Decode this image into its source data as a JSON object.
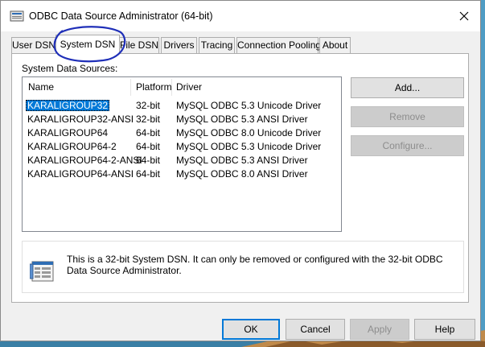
{
  "window": {
    "title": "ODBC Data Source Administrator (64-bit)"
  },
  "tabs": [
    {
      "label": "User DSN",
      "active": false
    },
    {
      "label": "System DSN",
      "active": true
    },
    {
      "label": "File DSN",
      "active": false
    },
    {
      "label": "Drivers",
      "active": false
    },
    {
      "label": "Tracing",
      "active": false
    },
    {
      "label": "Connection Pooling",
      "active": false
    },
    {
      "label": "About",
      "active": false
    }
  ],
  "panel": {
    "section_label": "System Data Sources:",
    "columns": [
      "Name",
      "Platform",
      "Driver"
    ],
    "rows": [
      {
        "name": "KARALIGROUP32",
        "platform": "32-bit",
        "driver": "MySQL ODBC 5.3 Unicode Driver",
        "selected": true
      },
      {
        "name": "KARALIGROUP32-ANSI",
        "platform": "32-bit",
        "driver": "MySQL ODBC 5.3 ANSI Driver",
        "selected": false
      },
      {
        "name": "KARALIGROUP64",
        "platform": "64-bit",
        "driver": "MySQL ODBC 8.0 Unicode Driver",
        "selected": false
      },
      {
        "name": "KARALIGROUP64-2",
        "platform": "64-bit",
        "driver": "MySQL ODBC 5.3 Unicode Driver",
        "selected": false
      },
      {
        "name": "KARALIGROUP64-2-ANSI",
        "platform": "64-bit",
        "driver": "MySQL ODBC 5.3 ANSI Driver",
        "selected": false
      },
      {
        "name": "KARALIGROUP64-ANSI",
        "platform": "64-bit",
        "driver": "MySQL ODBC 8.0 ANSI Driver",
        "selected": false
      }
    ],
    "side_buttons": {
      "add": "Add...",
      "remove": "Remove",
      "configure": "Configure..."
    },
    "info_text": "This is a 32-bit System DSN. It can only be removed or configured with the 32-bit ODBC Data Source Administrator."
  },
  "dialog_buttons": {
    "ok": "OK",
    "cancel": "Cancel",
    "apply": "Apply",
    "help": "Help"
  },
  "colors": {
    "selection": "#0078d7",
    "annotation_circle": "#1f2fb8",
    "disabled_text": "#8d8d8d"
  },
  "icons": {
    "app": "odbc-admin-icon",
    "close": "close-icon",
    "info": "datasource-info-icon"
  }
}
